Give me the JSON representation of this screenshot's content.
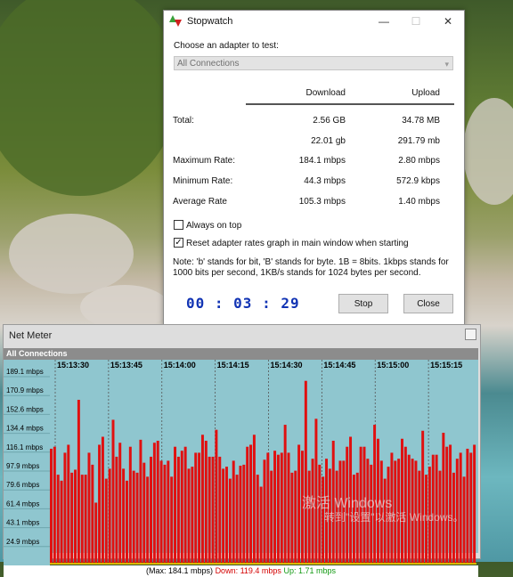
{
  "desktop": {
    "watermark_line1": "激活 Windows",
    "watermark_line2": "转到\"设置\"以激活 Windows。"
  },
  "stopwatch": {
    "title": "Stopwatch",
    "choose_label": "Choose an adapter to test:",
    "adapter_selected": "All Connections",
    "col_download": "Download",
    "col_upload": "Upload",
    "rows": [
      {
        "label": "Total:",
        "download": "2.56 GB",
        "upload": "34.78 MB"
      },
      {
        "label": "",
        "download": "22.01 gb",
        "upload": "291.79 mb"
      },
      {
        "label": "Maximum Rate:",
        "download": "184.1 mbps",
        "upload": "2.80 mbps"
      },
      {
        "label": "Minimum Rate:",
        "download": "44.3 mbps",
        "upload": "572.9 kbps"
      },
      {
        "label": "Average Rate",
        "download": "105.3 mbps",
        "upload": "1.40 mbps"
      }
    ],
    "always_on_top_label": "Always on top",
    "always_on_top_checked": false,
    "reset_label": "Reset adapter rates graph in main window when starting",
    "reset_checked": true,
    "note": "Note: 'b' stands for bit, 'B' stands for byte. 1B = 8bits. 1kbps stands for 1000 bits per second, 1KB/s stands for 1024 bytes per second.",
    "timer": "00 : 03 : 29",
    "stop_label": "Stop",
    "close_label": "Close"
  },
  "netmeter": {
    "title": "Net Meter",
    "graph_title": "All Connections",
    "y_labels": [
      "189.1 mbps",
      "170.9 mbps",
      "152.6 mbps",
      "134.4 mbps",
      "116.1 mbps",
      "97.9 mbps",
      "79.6 mbps",
      "61.4 mbps",
      "43.1 mbps",
      "24.9 mbps"
    ],
    "time_labels": [
      "15:13:30",
      "15:13:45",
      "15:14:00",
      "15:14:15",
      "15:14:30",
      "15:14:45",
      "15:15:00",
      "15:15:15"
    ],
    "footer_max": "(Max: 184.1 mbps)",
    "footer_down": "Down: 119.4 mbps",
    "footer_up": "Up: 1.71 mbps",
    "colors": {
      "down": "#e01010",
      "up": "#e8e800",
      "down_text": "#d40000",
      "up_text": "#119911"
    }
  },
  "chart_data": {
    "type": "bar",
    "title": "All Connections",
    "ylim": [
      0,
      189.1
    ],
    "y_unit": "mbps",
    "series": [
      {
        "name": "Down",
        "values": [
          116,
          118,
          90,
          84,
          112,
          120,
          92,
          95,
          165,
          90,
          90,
          112,
          100,
          62,
          120,
          128,
          86,
          96,
          145,
          108,
          122,
          96,
          84,
          118,
          94,
          92,
          125,
          102,
          88,
          108,
          122,
          124,
          104,
          100,
          104,
          88,
          118,
          108,
          114,
          118,
          96,
          98,
          112,
          112,
          130,
          124,
          108,
          108,
          135,
          108,
          96,
          98,
          86,
          104,
          90,
          99,
          100,
          118,
          120,
          130,
          90,
          78,
          105,
          112,
          94,
          114,
          110,
          112,
          140,
          112,
          92,
          94,
          120,
          114,
          184,
          94,
          106,
          146,
          100,
          88,
          106,
          96,
          124,
          94,
          104,
          104,
          118,
          128,
          90,
          92,
          118,
          118,
          106,
          100,
          140,
          126,
          104,
          86,
          98,
          112,
          104,
          106,
          126,
          118,
          110,
          106,
          104,
          94,
          134,
          90,
          98,
          110,
          110,
          94,
          132,
          118,
          120,
          92,
          106,
          112,
          88,
          116,
          112,
          120
        ]
      }
    ]
  }
}
